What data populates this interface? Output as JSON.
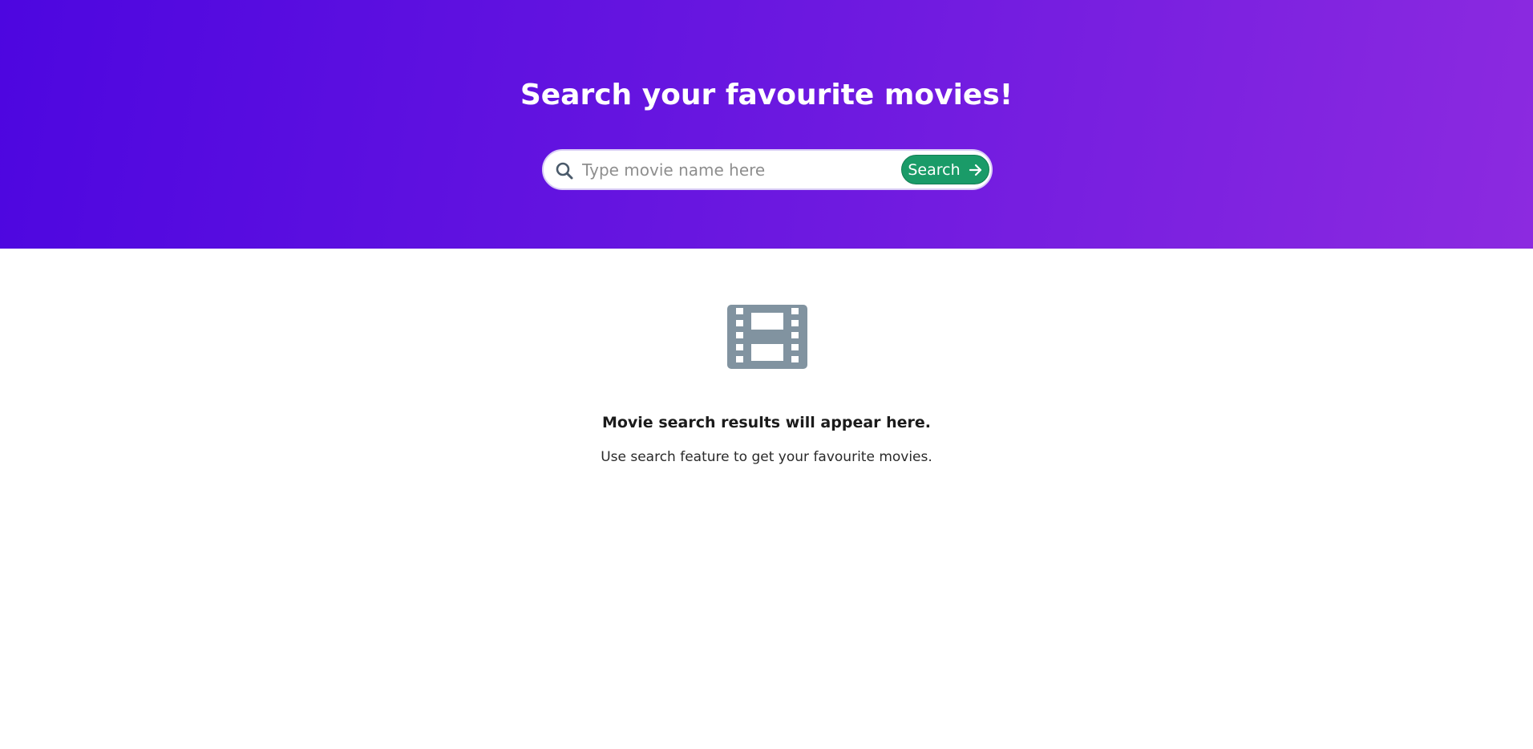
{
  "header": {
    "title": "Search your favourite movies!"
  },
  "search": {
    "placeholder": "Type movie name here",
    "value": "",
    "button_label": "Search",
    "button_icon": "arrow-right-icon",
    "leading_icon": "search-icon",
    "button_color": "#1a9b68"
  },
  "empty_state": {
    "icon": "film-icon",
    "icon_color": "#8193a0",
    "title": "Movie search results will appear here.",
    "subtitle": "Use search feature to get your favourite movies."
  },
  "colors": {
    "gradient_start": "#4d06e0",
    "gradient_end": "#8c2ae0"
  }
}
